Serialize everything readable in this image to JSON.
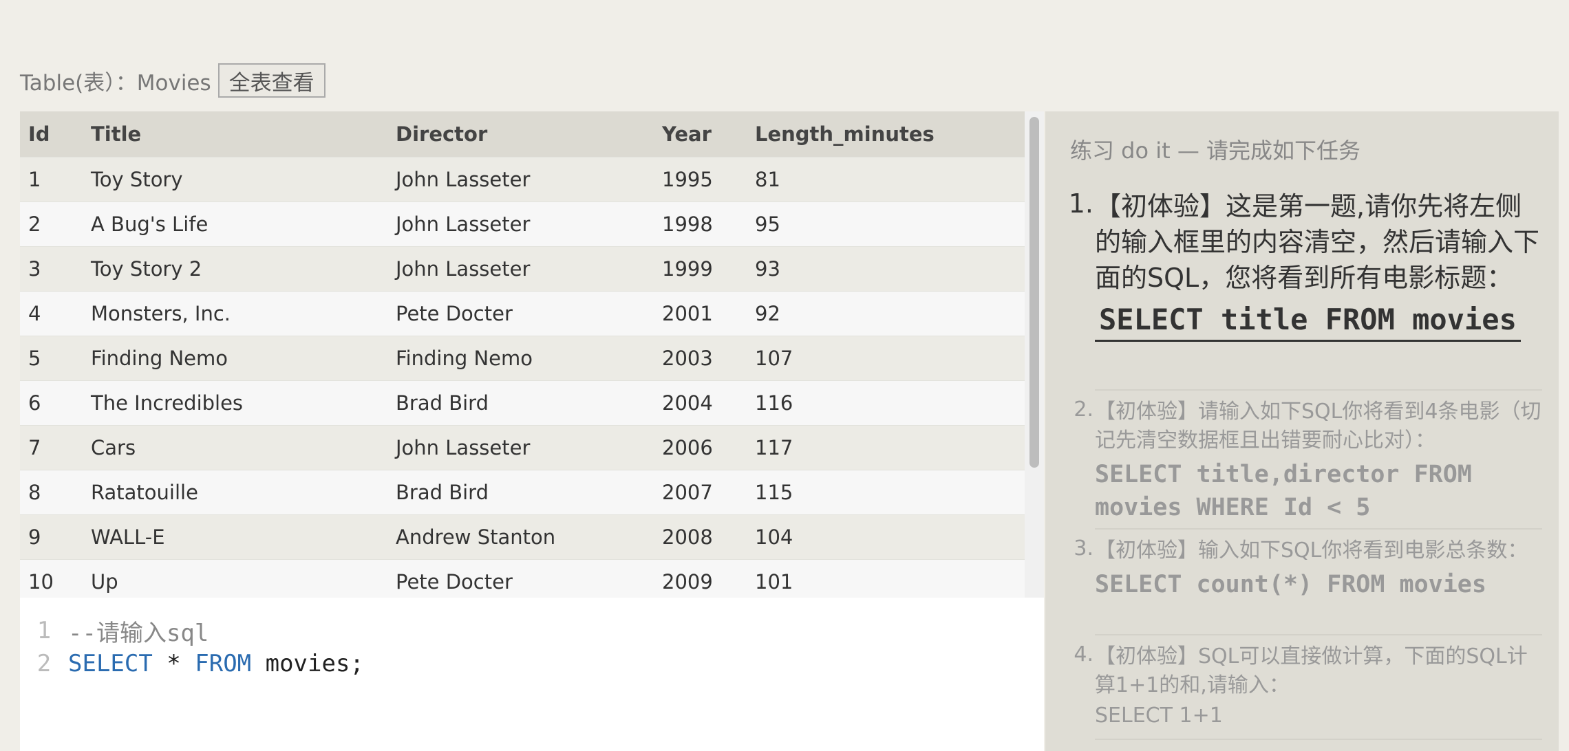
{
  "header": {
    "table_label": "Table(表）：Movies",
    "view_all_button": "全表查看"
  },
  "table": {
    "columns": [
      "Id",
      "Title",
      "Director",
      "Year",
      "Length_minutes"
    ],
    "rows": [
      [
        "1",
        "Toy Story",
        "John Lasseter",
        "1995",
        "81"
      ],
      [
        "2",
        "A Bug's Life",
        "John Lasseter",
        "1998",
        "95"
      ],
      [
        "3",
        "Toy Story 2",
        "John Lasseter",
        "1999",
        "93"
      ],
      [
        "4",
        "Monsters, Inc.",
        "Pete Docter",
        "2001",
        "92"
      ],
      [
        "5",
        "Finding Nemo",
        "Finding Nemo",
        "2003",
        "107"
      ],
      [
        "6",
        "The Incredibles",
        "Brad Bird",
        "2004",
        "116"
      ],
      [
        "7",
        "Cars",
        "John Lasseter",
        "2006",
        "117"
      ],
      [
        "8",
        "Ratatouille",
        "Brad Bird",
        "2007",
        "115"
      ],
      [
        "9",
        "WALL-E",
        "Andrew Stanton",
        "2008",
        "104"
      ],
      [
        "10",
        "Up",
        "Pete Docter",
        "2009",
        "101"
      ]
    ]
  },
  "editor": {
    "lines": [
      {
        "number": "1",
        "comment": "--请输入sql"
      },
      {
        "number": "2",
        "kw1": "SELECT",
        "t1": " * ",
        "kw2": "FROM",
        "t2": " movies;"
      }
    ]
  },
  "tasks": {
    "title": "练习 do it — 请完成如下任务",
    "items": [
      {
        "num": "1.",
        "text": "【初体验】这是第一题,请你先将左侧的输入框里的内容清空，然后请输入下面的SQL，您将看到所有电影标题：",
        "sql": "SELECT title FROM movies"
      },
      {
        "num": "2.",
        "text": "【初体验】请输入如下SQL你将看到4条电影（切记先清空数据框且出错要耐心比对）：",
        "sql": "SELECT title,director FROM movies WHERE Id < 5"
      },
      {
        "num": "3.",
        "text": "【初体验】输入如下SQL你将看到电影总条数：",
        "sql": "SELECT count(*) FROM movies"
      },
      {
        "num": "4.",
        "text": "【初体验】SQL可以直接做计算，下面的SQL计算1+1的和,请输入：",
        "sql": "SELECT 1+1"
      }
    ]
  }
}
